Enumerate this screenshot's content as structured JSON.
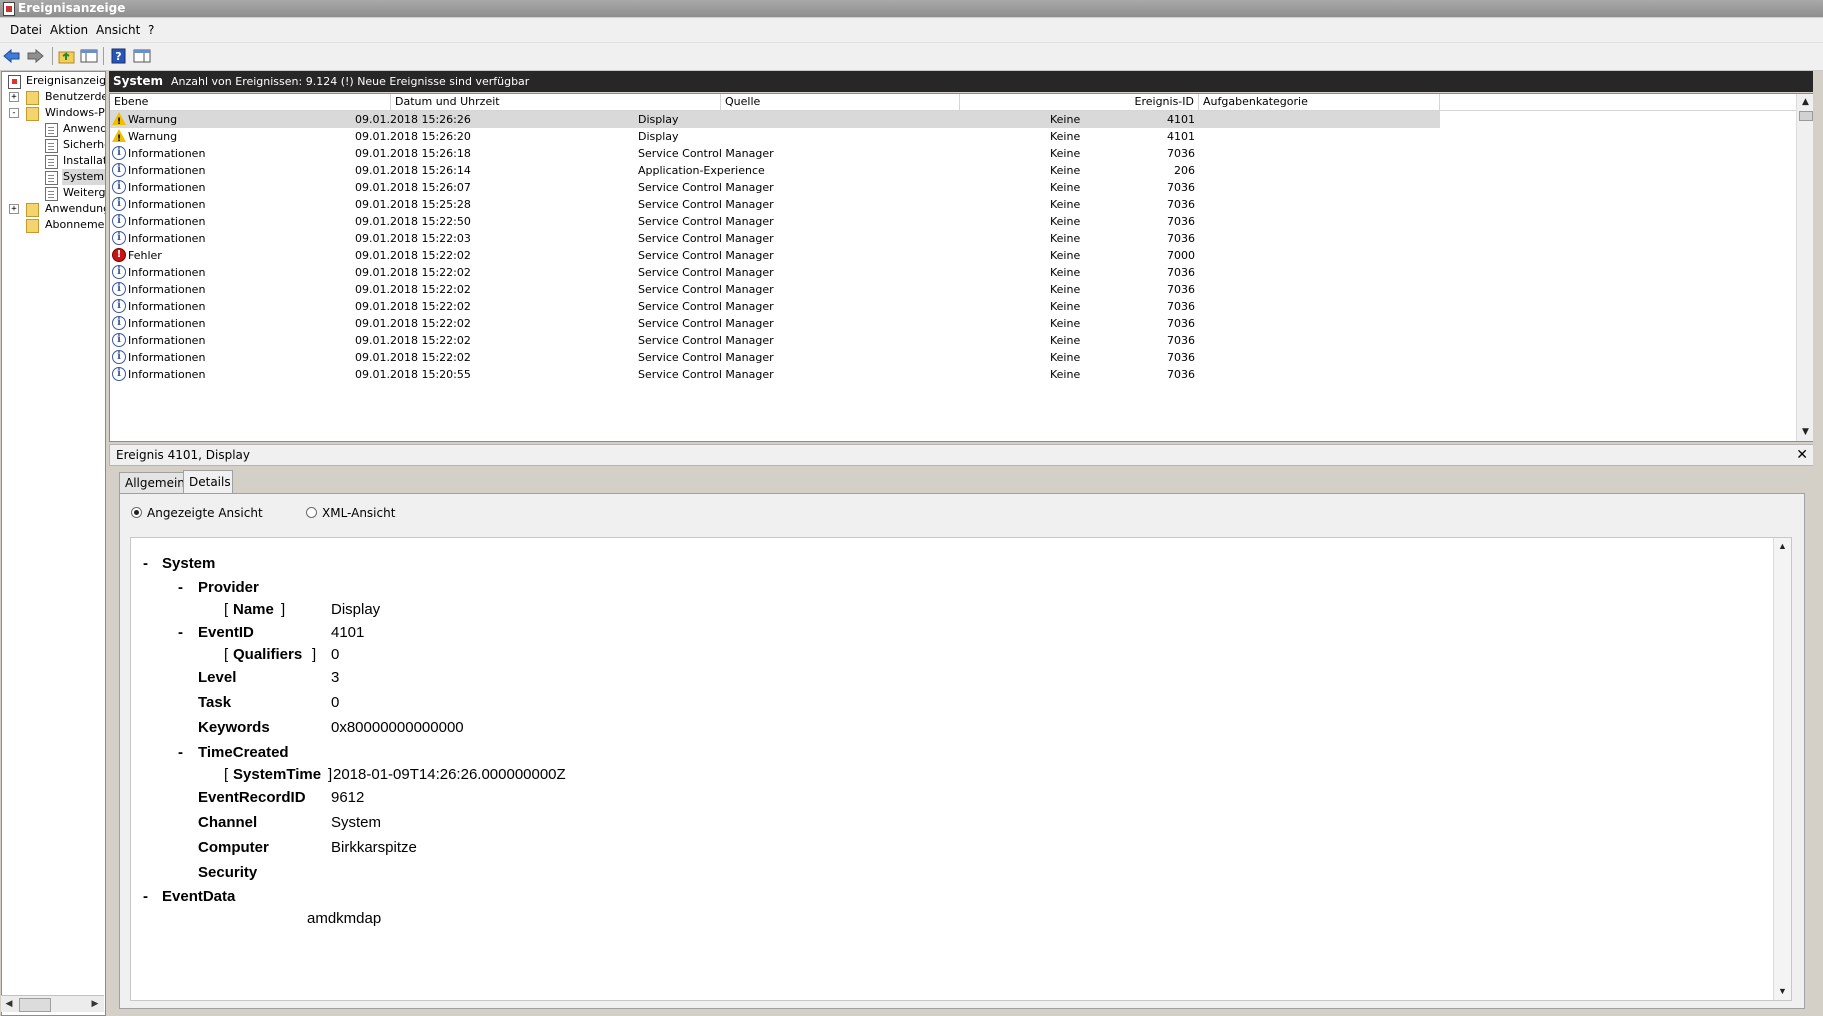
{
  "window": {
    "title": "Ereignisanzeige"
  },
  "menu": {
    "items": [
      "Datei",
      "Aktion",
      "Ansicht",
      "?"
    ]
  },
  "tree": {
    "items": [
      {
        "label": "Ereignisanzeige",
        "icon": "root-icon",
        "expander": ""
      },
      {
        "label": "Benutzerdef",
        "icon": "folder-icon",
        "expander": "+"
      },
      {
        "label": "Windows-Pr",
        "icon": "folder-icon",
        "expander": "-"
      },
      {
        "label": "Anwend",
        "icon": "log-icon",
        "expander": ""
      },
      {
        "label": "Sicherhe",
        "icon": "log-icon",
        "expander": ""
      },
      {
        "label": "Installat",
        "icon": "log-icon",
        "expander": ""
      },
      {
        "label": "System",
        "icon": "log-icon",
        "expander": ""
      },
      {
        "label": "Weiterg",
        "icon": "log-icon",
        "expander": ""
      },
      {
        "label": "Anwendung",
        "icon": "folder-icon",
        "expander": "+"
      },
      {
        "label": "Abonnemen",
        "icon": "folder-icon",
        "expander": ""
      }
    ]
  },
  "list_header": {
    "title": "System",
    "info": "Anzahl von Ereignissen: 9.124 (!) Neue Ereignisse sind verfügbar"
  },
  "columns": [
    "Ebene",
    "Datum und Uhrzeit",
    "Quelle",
    "Ereignis-ID",
    "Aufgabenkategorie"
  ],
  "events": [
    {
      "level": "Warnung",
      "icon": "warning-icon",
      "datetime": "09.01.2018 15:26:26",
      "source": "Display",
      "id": "4101",
      "category": "Keine"
    },
    {
      "level": "Warnung",
      "icon": "warning-icon",
      "datetime": "09.01.2018 15:26:20",
      "source": "Display",
      "id": "4101",
      "category": "Keine"
    },
    {
      "level": "Informationen",
      "icon": "info-icon",
      "datetime": "09.01.2018 15:26:18",
      "source": "Service Control Manager",
      "id": "7036",
      "category": "Keine"
    },
    {
      "level": "Informationen",
      "icon": "info-icon",
      "datetime": "09.01.2018 15:26:14",
      "source": "Application-Experience",
      "id": "206",
      "category": "Keine"
    },
    {
      "level": "Informationen",
      "icon": "info-icon",
      "datetime": "09.01.2018 15:26:07",
      "source": "Service Control Manager",
      "id": "7036",
      "category": "Keine"
    },
    {
      "level": "Informationen",
      "icon": "info-icon",
      "datetime": "09.01.2018 15:25:28",
      "source": "Service Control Manager",
      "id": "7036",
      "category": "Keine"
    },
    {
      "level": "Informationen",
      "icon": "info-icon",
      "datetime": "09.01.2018 15:22:50",
      "source": "Service Control Manager",
      "id": "7036",
      "category": "Keine"
    },
    {
      "level": "Informationen",
      "icon": "info-icon",
      "datetime": "09.01.2018 15:22:03",
      "source": "Service Control Manager",
      "id": "7036",
      "category": "Keine"
    },
    {
      "level": "Fehler",
      "icon": "error-icon",
      "datetime": "09.01.2018 15:22:02",
      "source": "Service Control Manager",
      "id": "7000",
      "category": "Keine"
    },
    {
      "level": "Informationen",
      "icon": "info-icon",
      "datetime": "09.01.2018 15:22:02",
      "source": "Service Control Manager",
      "id": "7036",
      "category": "Keine"
    },
    {
      "level": "Informationen",
      "icon": "info-icon",
      "datetime": "09.01.2018 15:22:02",
      "source": "Service Control Manager",
      "id": "7036",
      "category": "Keine"
    },
    {
      "level": "Informationen",
      "icon": "info-icon",
      "datetime": "09.01.2018 15:22:02",
      "source": "Service Control Manager",
      "id": "7036",
      "category": "Keine"
    },
    {
      "level": "Informationen",
      "icon": "info-icon",
      "datetime": "09.01.2018 15:22:02",
      "source": "Service Control Manager",
      "id": "7036",
      "category": "Keine"
    },
    {
      "level": "Informationen",
      "icon": "info-icon",
      "datetime": "09.01.2018 15:22:02",
      "source": "Service Control Manager",
      "id": "7036",
      "category": "Keine"
    },
    {
      "level": "Informationen",
      "icon": "info-icon",
      "datetime": "09.01.2018 15:22:02",
      "source": "Service Control Manager",
      "id": "7036",
      "category": "Keine"
    },
    {
      "level": "Informationen",
      "icon": "info-icon",
      "datetime": "09.01.2018 15:20:55",
      "source": "Service Control Manager",
      "id": "7036",
      "category": "Keine"
    }
  ],
  "detail": {
    "title": "Ereignis 4101, Display",
    "tabs": [
      "Allgemein",
      "Details"
    ],
    "active_tab": "Details",
    "view_options": [
      "Angezeigte Ansicht",
      "XML-Ansicht"
    ],
    "selected_view": "Angezeigte Ansicht",
    "xml": {
      "system": "System",
      "provider": "Provider",
      "name_key": "Name",
      "name_val": "Display",
      "eventid_key": "EventID",
      "eventid_val": "4101",
      "qualifiers_key": "Qualifiers",
      "qualifiers_val": "0",
      "level_key": "Level",
      "level_val": "3",
      "task_key": "Task",
      "task_val": "0",
      "keywords_key": "Keywords",
      "keywords_val": "0x80000000000000",
      "timecreated_key": "TimeCreated",
      "systemtime_key": "SystemTime",
      "systemtime_val": "2018-01-09T14:26:26.000000000Z",
      "eventrecordid_key": "EventRecordID",
      "eventrecordid_val": "9612",
      "channel_key": "Channel",
      "channel_val": "System",
      "computer_key": "Computer",
      "computer_val": "Birkkarspitze",
      "security_key": "Security",
      "eventdata": "EventData",
      "eventdata_val": "amdkmdap"
    }
  }
}
